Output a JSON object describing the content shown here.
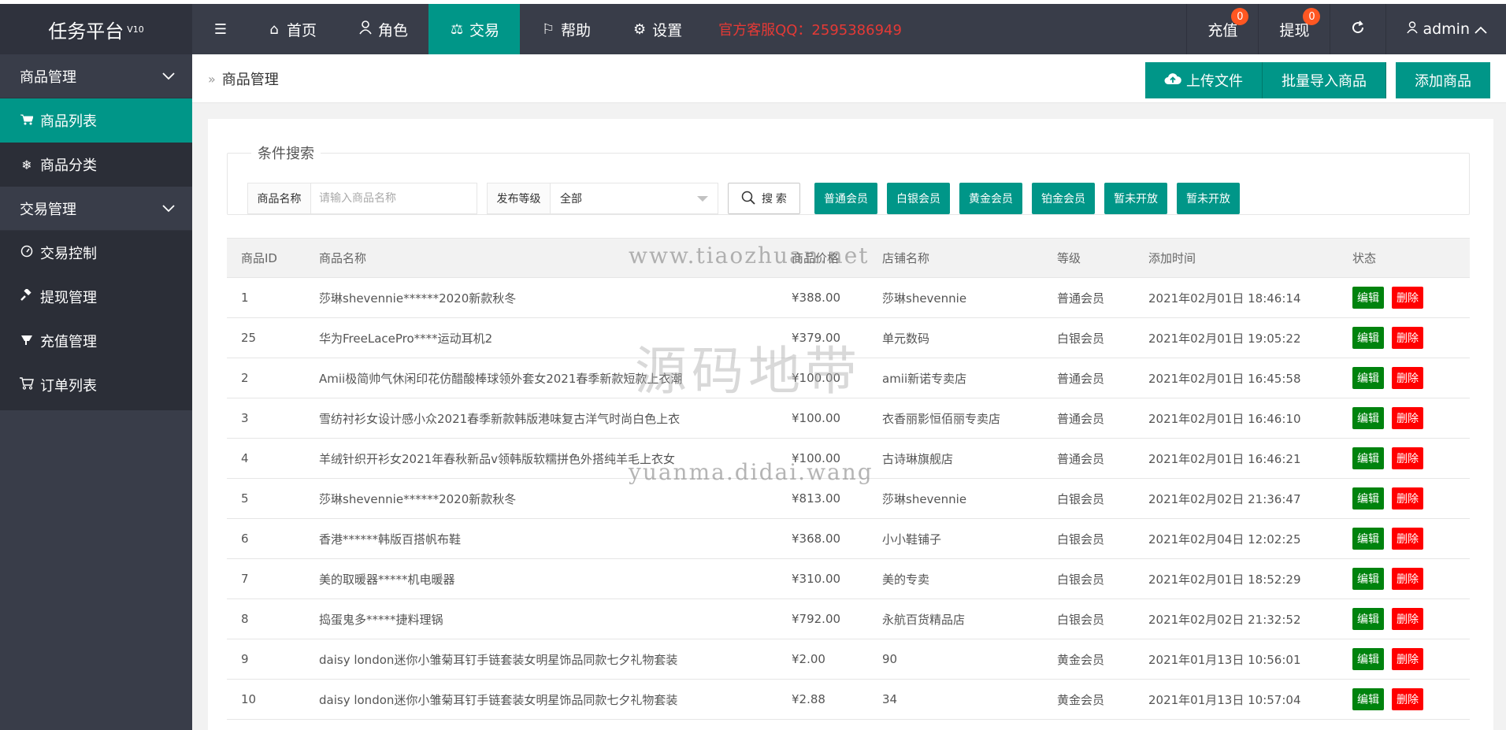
{
  "header": {
    "logo": "任务平台",
    "version": "V10",
    "nav": [
      {
        "label": "首页",
        "icon": "home-icon",
        "glyph": "⌂"
      },
      {
        "label": "角色",
        "icon": "user-icon",
        "glyph": "⍝"
      },
      {
        "label": "交易",
        "icon": "scale-icon",
        "glyph": "⚖"
      },
      {
        "label": "帮助",
        "icon": "flag-icon",
        "glyph": "⚐"
      },
      {
        "label": "设置",
        "icon": "gear-icon",
        "glyph": "⚙"
      }
    ],
    "kefu": "官方客服QQ：2595386949",
    "recharge": "充值",
    "recharge_badge": "0",
    "withdraw": "提现",
    "withdraw_badge": "0",
    "user": "admin"
  },
  "sidebar": {
    "groups": [
      {
        "title": "商品管理",
        "items": [
          {
            "label": "商品列表",
            "icon": "cart-icon",
            "glyph": "🛒",
            "active": true
          },
          {
            "label": "商品分类",
            "icon": "snowflake-icon",
            "glyph": "❄",
            "active": false
          }
        ]
      },
      {
        "title": "交易管理",
        "items": [
          {
            "label": "交易控制",
            "icon": "dashboard-icon",
            "glyph": "◔",
            "active": false
          },
          {
            "label": "提现管理",
            "icon": "gavel-icon",
            "glyph": "⚒",
            "active": false
          },
          {
            "label": "充值管理",
            "icon": "bullhorn-icon",
            "glyph": "◢",
            "active": false
          },
          {
            "label": "订单列表",
            "icon": "cart-outline-icon",
            "glyph": "⛟",
            "active": false
          }
        ]
      }
    ]
  },
  "content": {
    "breadcrumb": "商品管理",
    "upload_btn": "上传文件",
    "import_btn": "批量导入商品",
    "add_btn": "添加商品"
  },
  "search": {
    "legend": "条件搜索",
    "name_label": "商品名称",
    "name_placeholder": "请输入商品名称",
    "level_label": "发布等级",
    "level_value": "全部",
    "search_btn": "搜 索",
    "level_buttons": [
      "普通会员",
      "白银会员",
      "黄金会员",
      "铂金会员",
      "暂未开放",
      "暂未开放"
    ]
  },
  "table": {
    "headers": [
      "商品ID",
      "商品名称",
      "商品价格",
      "店铺名称",
      "等级",
      "添加时间",
      "状态"
    ],
    "edit_label": "编辑",
    "delete_label": "删除",
    "rows": [
      [
        "1",
        "莎琳shevennie******2020新款秋冬",
        "¥388.00",
        "莎琳shevennie",
        "普通会员",
        "2021年02月01日 18:46:14"
      ],
      [
        "25",
        "华为FreeLacePro****运动耳机2",
        "¥379.00",
        "单元数码",
        "白银会员",
        "2021年02月01日 19:05:22"
      ],
      [
        "2",
        "Amii极简帅气休闲印花仿醋酸棒球领外套女2021春季新款短款上衣潮",
        "¥100.00",
        "amii新诺专卖店",
        "普通会员",
        "2021年02月01日 16:45:58"
      ],
      [
        "3",
        "雪纺衬衫女设计感小众2021春季新款韩版港味复古洋气时尚白色上衣",
        "¥100.00",
        "衣香丽影恒佰丽专卖店",
        "普通会员",
        "2021年02月01日 16:46:10"
      ],
      [
        "4",
        "羊绒针织开衫女2021年春秋新品v领韩版软糯拼色外搭纯羊毛上衣女",
        "¥100.00",
        "古诗琳旗舰店",
        "普通会员",
        "2021年02月01日 16:46:21"
      ],
      [
        "5",
        "莎琳shevennie******2020新款秋冬",
        "¥813.00",
        "莎琳shevennie",
        "白银会员",
        "2021年02月02日 21:36:47"
      ],
      [
        "6",
        "香港******韩版百搭帆布鞋",
        "¥368.00",
        "小小鞋铺子",
        "白银会员",
        "2021年02月04日 12:02:25"
      ],
      [
        "7",
        "美的取暖器*****机电暖器",
        "¥310.00",
        "美的专卖",
        "白银会员",
        "2021年02月01日 18:52:29"
      ],
      [
        "8",
        "捣蛋鬼多*****捷料理锅",
        "¥792.00",
        "永航百货精品店",
        "白银会员",
        "2021年02月02日 21:32:52"
      ],
      [
        "9",
        "daisy london迷你小雏菊耳钉手链套装女明星饰品同款七夕礼物套装",
        "¥2.00",
        "90",
        "黄金会员",
        "2021年01月13日 10:56:01"
      ],
      [
        "10",
        "daisy london迷你小雏菊耳钉手链套装女明星饰品同款七夕礼物套装",
        "¥2.88",
        "34",
        "黄金会员",
        "2021年01月13日 10:57:04"
      ]
    ]
  },
  "watermark": {
    "line1": "www.tiaozhuan.net",
    "line2": "源码地带",
    "line3": "yuanma.didai.wang"
  }
}
